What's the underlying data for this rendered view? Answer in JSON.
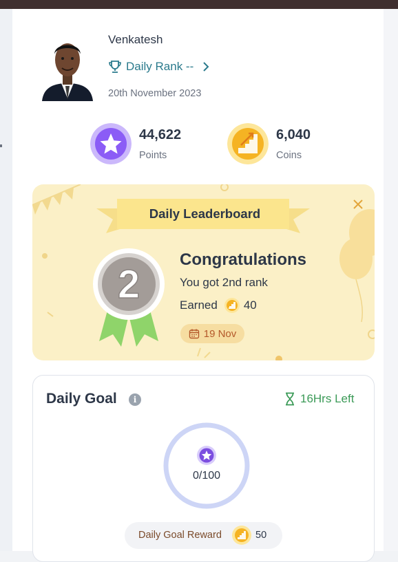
{
  "profile": {
    "name": "Venkatesh",
    "rank_label": "Daily Rank --",
    "date": "20th November 2023"
  },
  "stats": [
    {
      "value": "44,622",
      "label": "Points",
      "icon": "star-icon",
      "color": "#8b5cf6"
    },
    {
      "value": "6,040",
      "label": "Coins",
      "icon": "coin-icon",
      "color": "#f5b323"
    }
  ],
  "leaderboard": {
    "title": "Daily Leaderboard",
    "heading": "Congratulations",
    "message": "You got 2nd rank",
    "earned_label": "Earned",
    "earned_value": "40",
    "medal_rank": "2",
    "date": "19 Nov",
    "colors": {
      "background": "#fbf0c7",
      "ribbon": "#fbe58d",
      "medal_ribbon": "#8fd46a"
    }
  },
  "daily_goal": {
    "title": "Daily Goal",
    "time_left": "16Hrs Left",
    "progress": "0/100",
    "progress_fraction": 0,
    "reward_label": "Daily Goal Reward",
    "reward_value": "50"
  },
  "colors": {
    "accent_teal": "#2a7a8c",
    "success_green": "#3b9a57",
    "ring": "#cdd5f6"
  }
}
